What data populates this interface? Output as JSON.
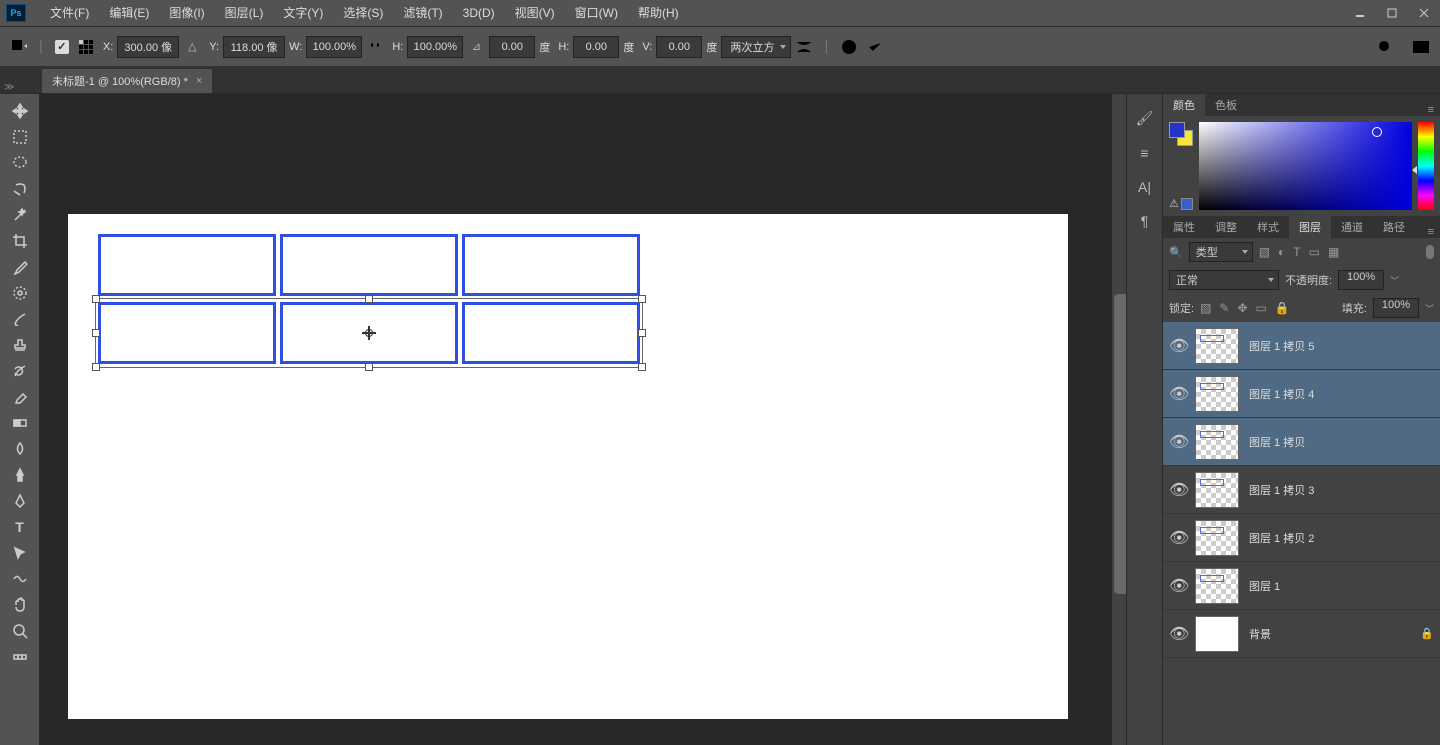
{
  "menu": {
    "items": [
      "文件(F)",
      "编辑(E)",
      "图像(I)",
      "图层(L)",
      "文字(Y)",
      "选择(S)",
      "滤镜(T)",
      "3D(D)",
      "视图(V)",
      "窗口(W)",
      "帮助(H)"
    ]
  },
  "options": {
    "x_label": "X:",
    "x": "300.00 像",
    "y_label": "Y:",
    "y": "118.00 像",
    "w_label": "W:",
    "w": "100.00%",
    "h_label": "H:",
    "h": "100.00%",
    "angle": "0.00",
    "angle_unit": "度",
    "hskew_label": "H:",
    "hskew": "0.00",
    "hskew_unit": "度",
    "vskew_label": "V:",
    "vskew": "0.00",
    "vskew_unit": "度",
    "interp": "两次立方"
  },
  "tab": {
    "title": "未标题-1 @ 100%(RGB/8) *"
  },
  "color_panel": {
    "tabs": [
      "颜色",
      "色板"
    ]
  },
  "layers_group": {
    "tabs": [
      "属性",
      "调整",
      "样式",
      "图层",
      "通道",
      "路径"
    ],
    "filter": "类型",
    "blend": "正常",
    "opacity_label": "不透明度:",
    "opacity": "100%",
    "lock_label": "锁定:",
    "fill_label": "填充:",
    "fill": "100%"
  },
  "layers": [
    {
      "name": "图层 1 拷贝 5",
      "sel": true,
      "mini": true
    },
    {
      "name": "图层 1 拷贝 4",
      "sel": true,
      "mini": true
    },
    {
      "name": "图层 1 拷贝",
      "sel": true,
      "mini": true
    },
    {
      "name": "图层 1 拷贝 3",
      "sel": false,
      "mini": true
    },
    {
      "name": "图层 1 拷贝 2",
      "sel": false,
      "mini": true
    },
    {
      "name": "图层 1",
      "sel": false,
      "mini": true
    },
    {
      "name": "背景",
      "sel": false,
      "mini": false,
      "locked": true,
      "white": true
    }
  ]
}
